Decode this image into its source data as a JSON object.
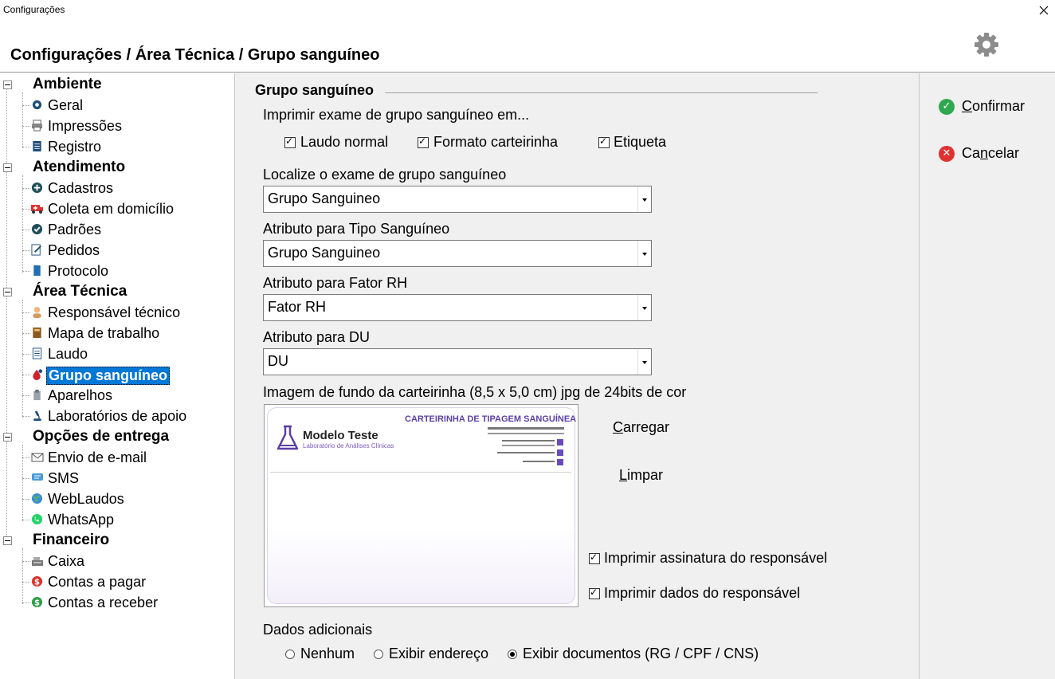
{
  "window": {
    "title": "Configurações"
  },
  "header": {
    "breadcrumb": "Configurações / Área Técnica / Grupo sanguíneo"
  },
  "sidebar": {
    "sections": [
      {
        "label": "Ambiente",
        "items": [
          "Geral",
          "Impressões",
          "Registro"
        ]
      },
      {
        "label": "Atendimento",
        "items": [
          "Cadastros",
          "Coleta em domicílio",
          "Padrões",
          "Pedidos",
          "Protocolo"
        ]
      },
      {
        "label": "Área Técnica",
        "items": [
          "Responsável técnico",
          "Mapa de trabalho",
          "Laudo",
          "Grupo sanguíneo",
          "Aparelhos",
          "Laboratórios de apoio"
        ]
      },
      {
        "label": "Opções de entrega",
        "items": [
          "Envio de e-mail",
          "SMS",
          "WebLaudos",
          "WhatsApp"
        ]
      },
      {
        "label": "Financeiro",
        "items": [
          "Caixa",
          "Contas a pagar",
          "Contas a receber"
        ]
      }
    ],
    "selected": "Grupo sanguíneo"
  },
  "panel": {
    "title": "Grupo sanguíneo",
    "print_label": "Imprimir exame de grupo sanguíneo em...",
    "print_options": {
      "laudo": "Laudo normal",
      "carteirinha": "Formato carteirinha",
      "etiqueta": "Etiqueta"
    },
    "locate_label": "Localize o exame de grupo sanguíneo",
    "locate_value": "Grupo Sanguineo",
    "tipo_label": "Atributo para Tipo Sanguíneo",
    "tipo_value": "Grupo Sanguineo",
    "fator_label": "Atributo para Fator RH",
    "fator_value": "Fator RH",
    "du_label": "Atributo para DU",
    "du_value": "DU",
    "image_label": "Imagem de fundo da carteirinha (8,5 x 5,0 cm) jpg de 24bits de cor",
    "load_first": "C",
    "load_rest": "arregar",
    "clear_first": "L",
    "clear_rest": "impar",
    "print_signature": "Imprimir assinatura do responsável",
    "print_data": "Imprimir dados do responsável",
    "additional_label": "Dados adicionais",
    "radio_none": "Nenhum",
    "radio_address": "Exibir endereço",
    "radio_docs": "Exibir documentos (RG / CPF / CNS)",
    "selected_radio": "Exibir documentos (RG / CPF / CNS)"
  },
  "card": {
    "title": "CARTEIRINHA DE TIPAGEM SANGUÍNEA",
    "brand": "Modelo Teste",
    "brand_sub": "Laboratório de Análises Clínicas"
  },
  "actions": {
    "confirm_first": "C",
    "confirm_rest": "onfirmar",
    "cancel_pre": "Ca",
    "cancel_ul": "n",
    "cancel_post": "celar"
  },
  "colors": {
    "selection": "#0078d7",
    "confirm": "#2fa84f",
    "cancel": "#e03131",
    "card_accent": "#5b3fa8"
  }
}
